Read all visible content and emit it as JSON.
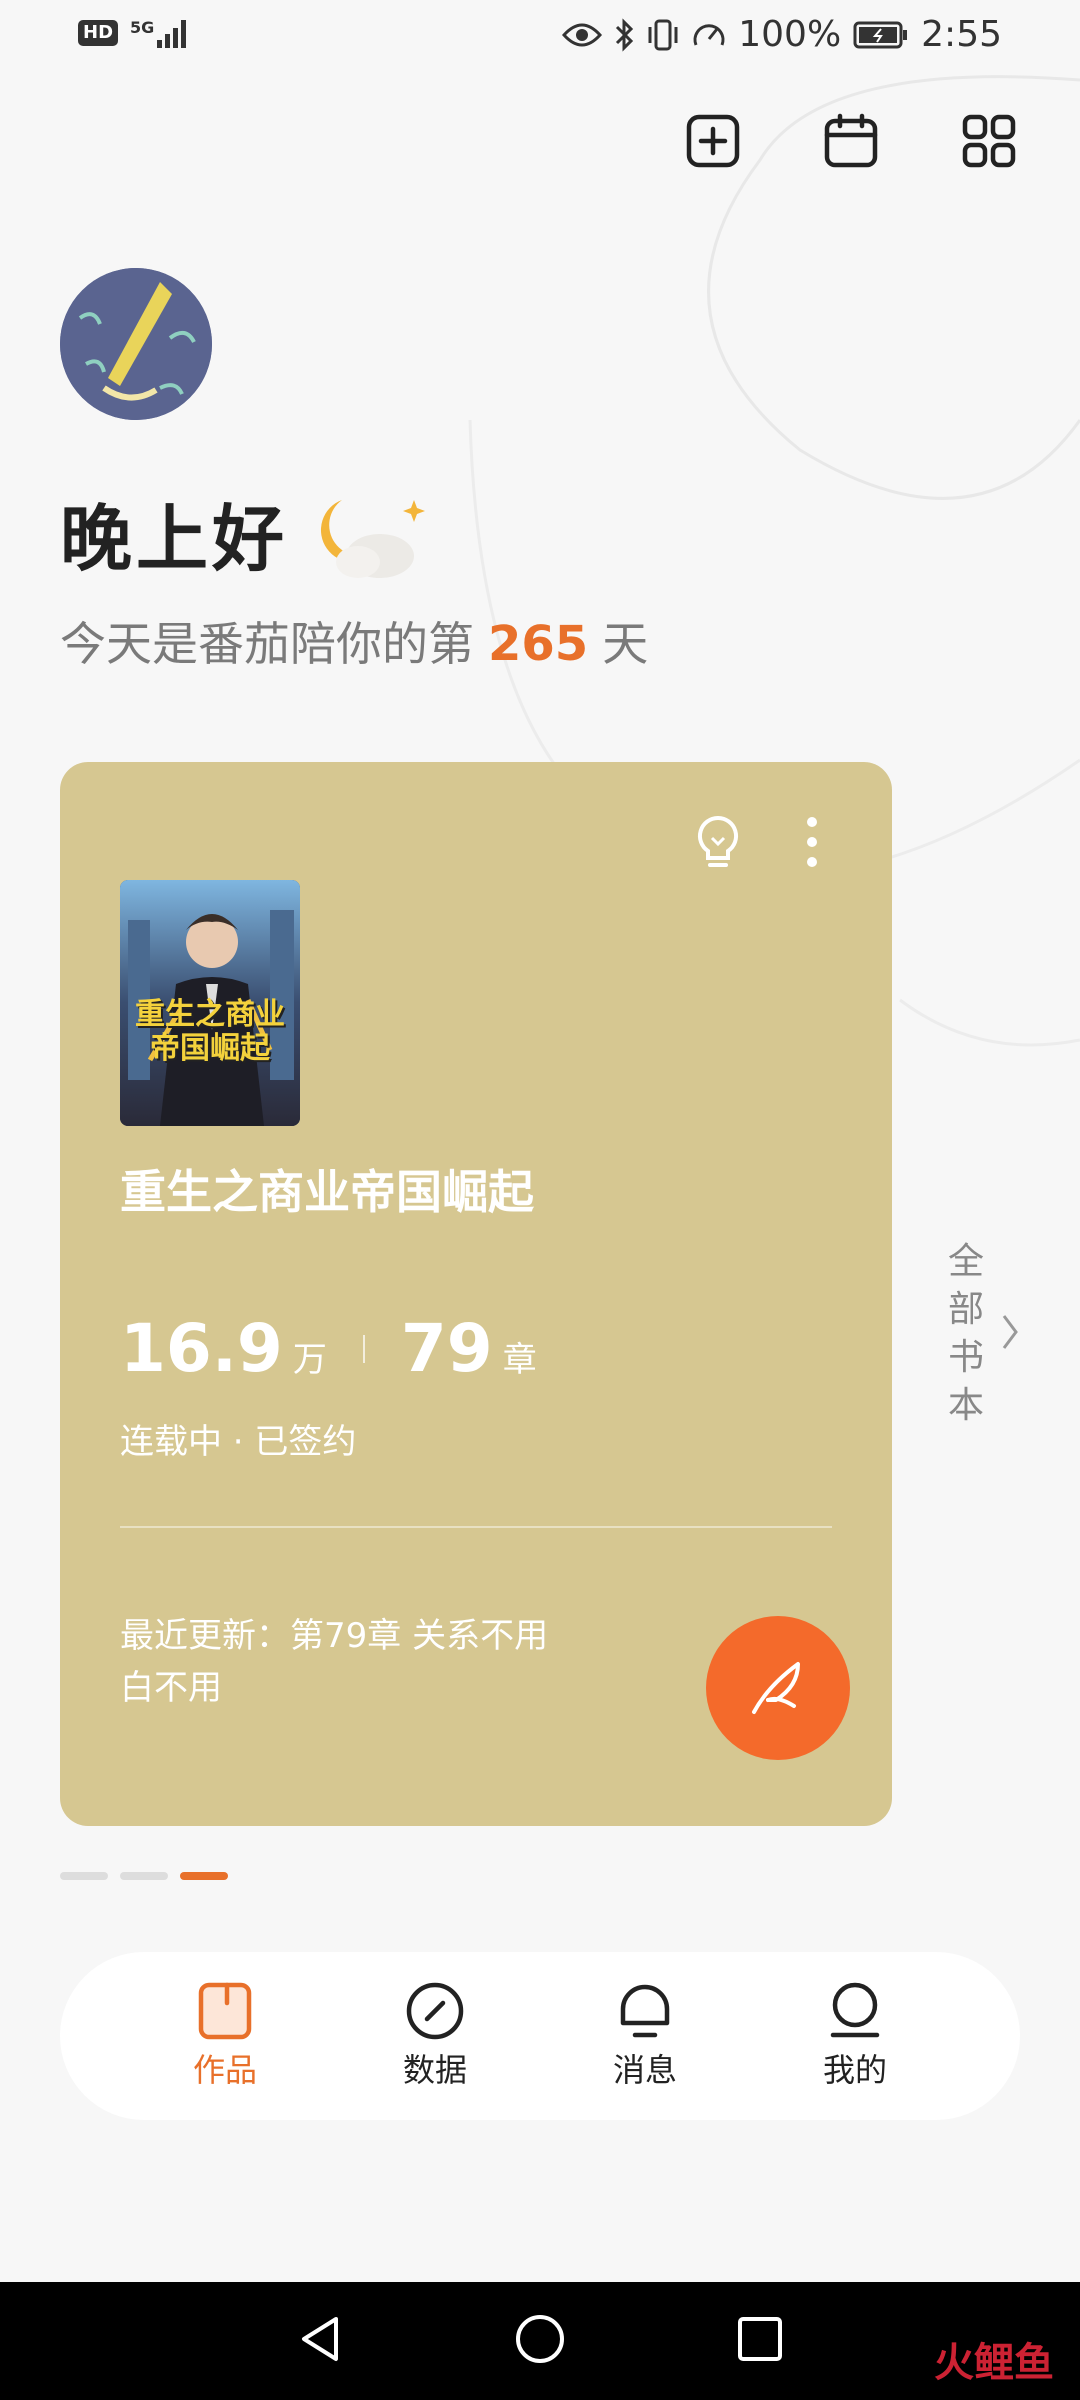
{
  "status_bar": {
    "hd": "HD",
    "network": "5G",
    "battery": "100%",
    "time": "2:55"
  },
  "header": {
    "icons": [
      "add-square-icon",
      "calendar-icon",
      "apps-grid-icon"
    ]
  },
  "greeting": {
    "title": "晚上好",
    "prefix": "今天是番茄陪你的第",
    "days": "265",
    "suffix": "天"
  },
  "book": {
    "cover_title": "重生之商业帝国崛起",
    "title": "重生之商业帝国崛起",
    "words": "16.9",
    "words_unit": "万",
    "chapters": "79",
    "chapters_unit": "章",
    "status": "连载中 · 已签约",
    "recent_update": "最近更新：第79章 关系不用白不用"
  },
  "all_books_label": [
    "全",
    "部",
    "书",
    "本"
  ],
  "pager": {
    "count": 3,
    "active_index": 2
  },
  "bottom_nav": [
    {
      "label": "作品",
      "icon": "works-icon",
      "active": true
    },
    {
      "label": "数据",
      "icon": "data-gauge-icon",
      "active": false
    },
    {
      "label": "消息",
      "icon": "message-bell-icon",
      "active": false
    },
    {
      "label": "我的",
      "icon": "profile-icon",
      "active": false
    }
  ],
  "watermark": "火鲤鱼",
  "colors": {
    "accent": "#e8702a",
    "card": "#d6c791",
    "fab": "#f46a2b"
  }
}
